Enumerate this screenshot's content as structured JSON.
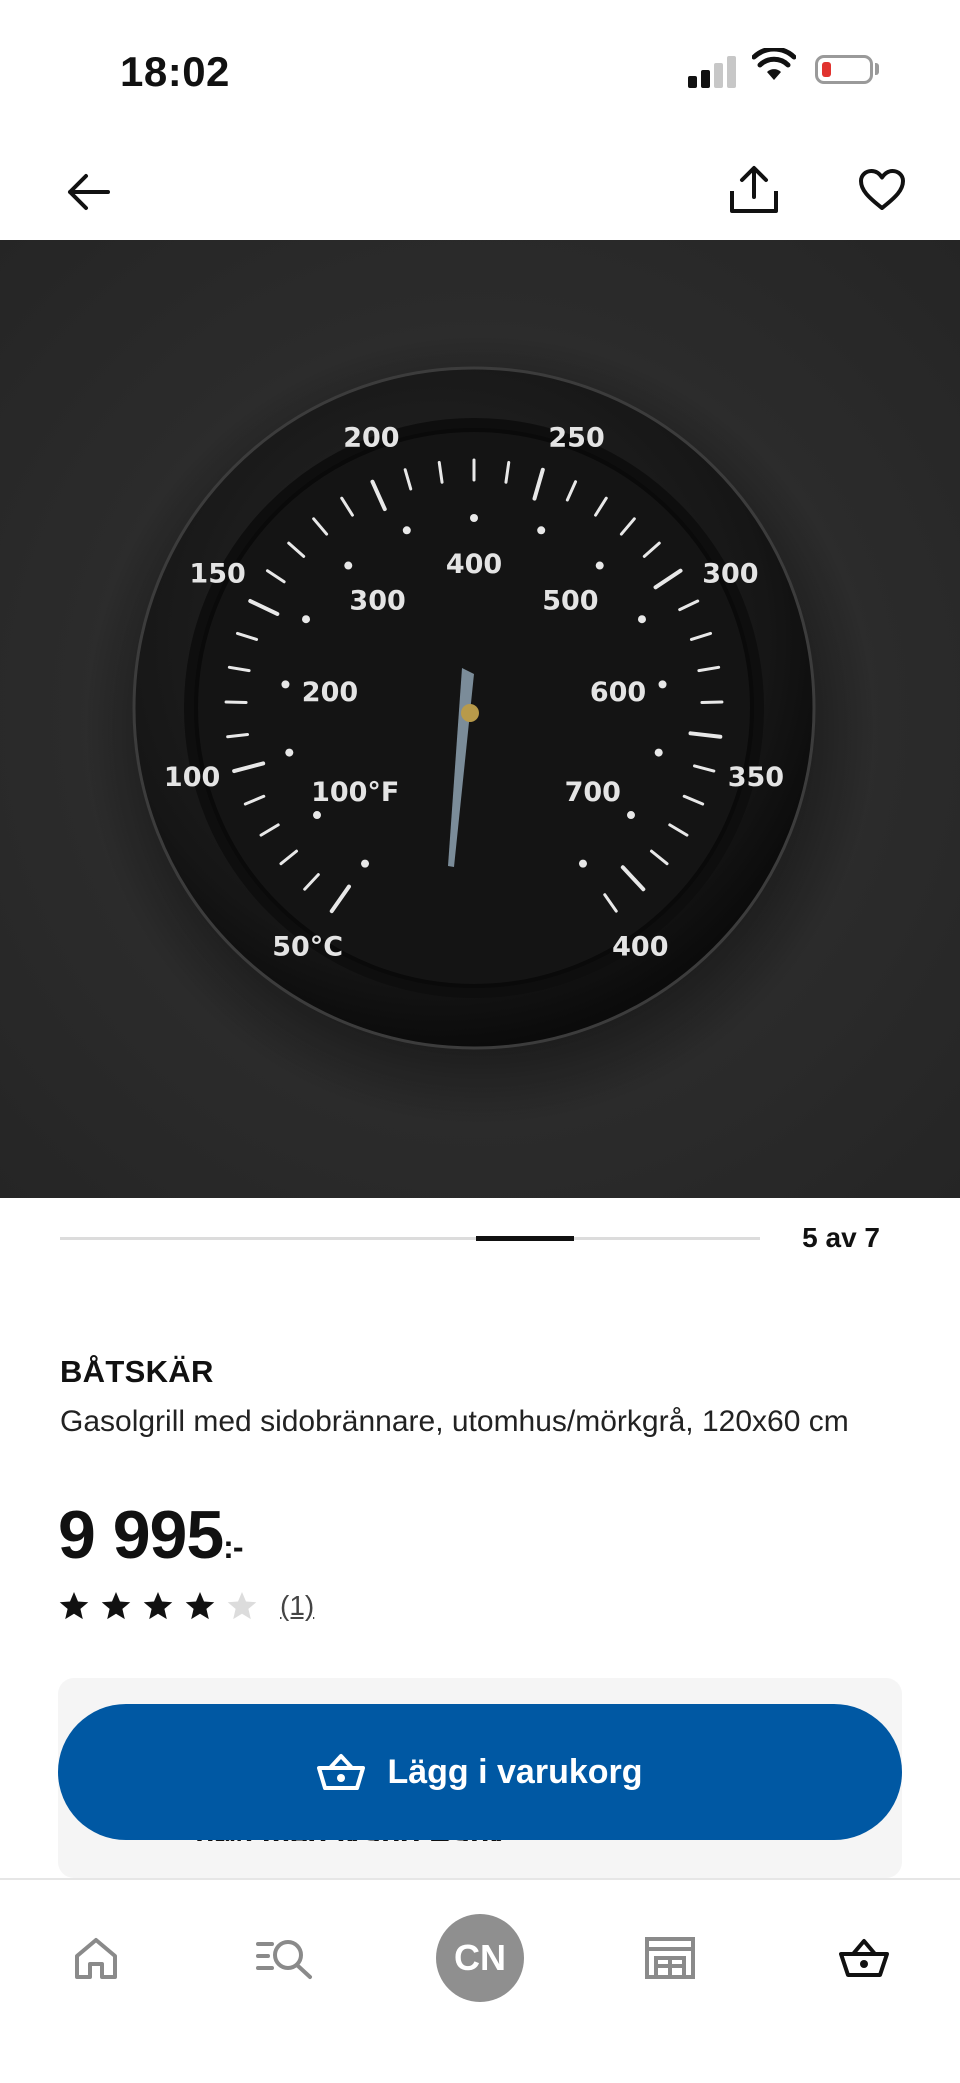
{
  "status_bar": {
    "time": "18:02"
  },
  "top_nav": {
    "back_icon": "arrow-left-icon",
    "share_icon": "share-icon",
    "favorite_icon": "heart-icon"
  },
  "gallery": {
    "image_description_icon": "thermometer-gauge-image",
    "gauge": {
      "outer_scale_labels": [
        "50°C",
        "100",
        "150",
        "200",
        "250",
        "300",
        "350",
        "400"
      ],
      "inner_scale_labels": [
        "100°F",
        "200",
        "300",
        "400",
        "500",
        "600",
        "700"
      ]
    },
    "pager": "5 av 7",
    "current_index": 5,
    "total": 7
  },
  "product": {
    "brand": "BÅTSKÄR",
    "description": "Gasolgrill med sidobrännare, utomhus/mörkgrå, 120x60 cm",
    "price": "9 995",
    "price_suffix": ":-",
    "rating": 4,
    "rating_max": 5,
    "review_count": "(1)"
  },
  "financing": {
    "partial_text": "0%) med Ikano Bank"
  },
  "cta": {
    "label": "Lägg i varukorg",
    "icon": "basket-icon",
    "color": "#0058a3"
  },
  "tab_bar": {
    "items": [
      {
        "name": "home",
        "icon": "home-icon"
      },
      {
        "name": "search",
        "icon": "search-list-icon"
      },
      {
        "name": "profile",
        "label": "CN"
      },
      {
        "name": "stores",
        "icon": "store-icon"
      },
      {
        "name": "cart",
        "icon": "basket-icon"
      }
    ]
  }
}
